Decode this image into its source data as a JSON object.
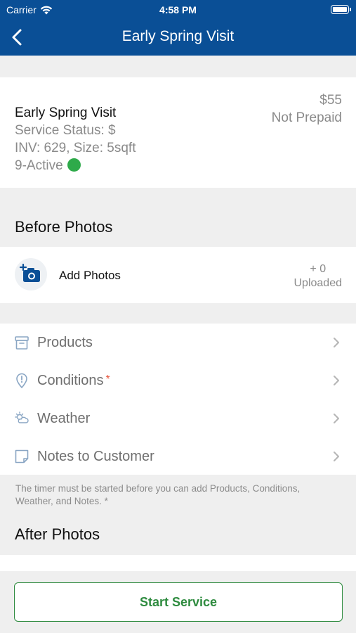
{
  "status_bar": {
    "carrier": "Carrier",
    "time": "4:58 PM"
  },
  "nav": {
    "title": "Early Spring Visit"
  },
  "service": {
    "name": "Early Spring Visit",
    "status": "Service Status: $",
    "inventory": "INV: 629, Size: 5sqft",
    "active": "9-Active",
    "price": "$55",
    "prepaid": "Not Prepaid",
    "active_color": "#2eaa4a"
  },
  "before_photos": {
    "title": "Before Photos",
    "add_label": "Add Photos",
    "count": "+ 0",
    "uploaded": "Uploaded"
  },
  "menu": {
    "items": [
      {
        "label": "Products",
        "icon": "archive-box-icon",
        "required": ""
      },
      {
        "label": "Conditions",
        "icon": "location-pin-alert-icon",
        "required": "*"
      },
      {
        "label": "Weather",
        "icon": "weather-cloud-sun-icon",
        "required": ""
      },
      {
        "label": "Notes to Customer",
        "icon": "note-icon",
        "required": ""
      }
    ]
  },
  "timer_note": "The timer must be started before you can add Products, Conditions, Weather, and Notes. *",
  "after_photos": {
    "title": "After Photos"
  },
  "actions": {
    "start_label": "Start Service"
  },
  "colors": {
    "brand": "#0a4f96",
    "accent_green": "#2e8b3f",
    "required_red": "#e8573e"
  }
}
